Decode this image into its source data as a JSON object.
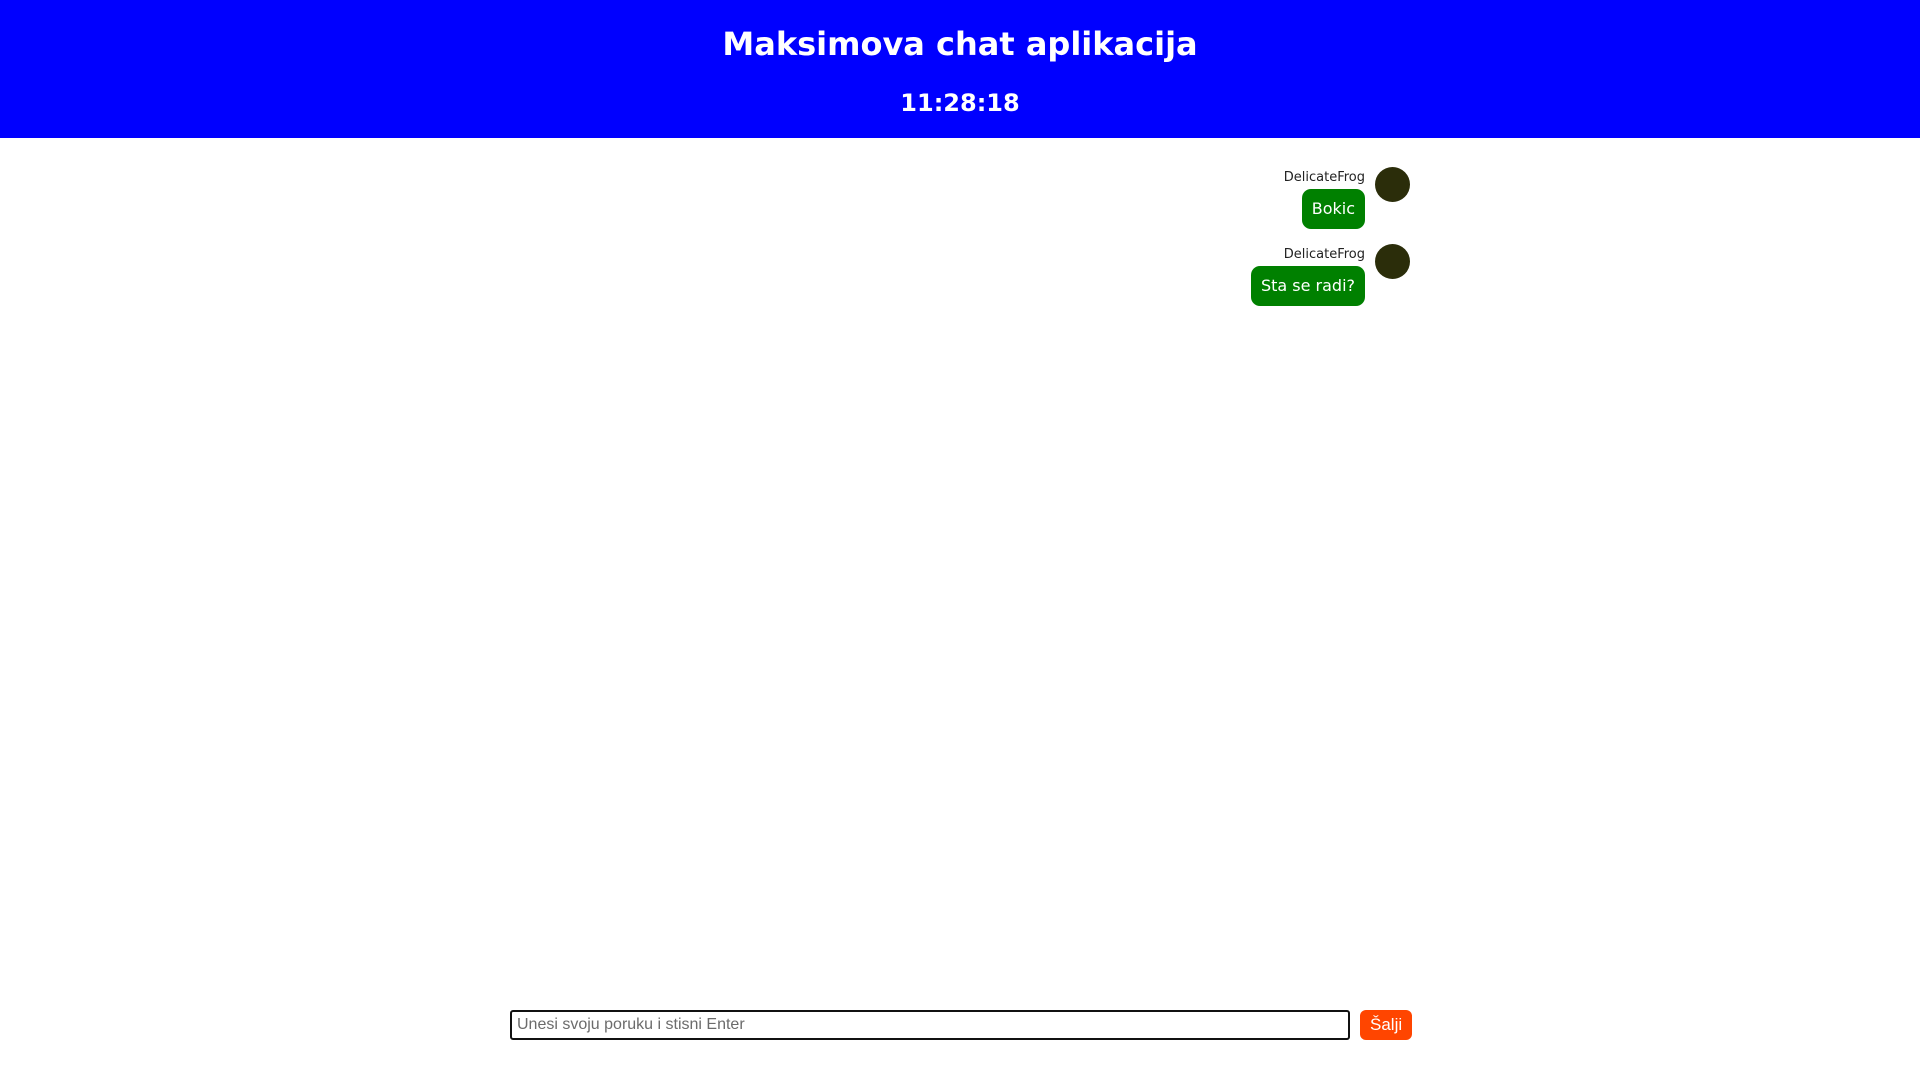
{
  "header": {
    "title": "Maksimova chat aplikacija",
    "clock": "11:28:18"
  },
  "messages": [
    {
      "sender": "DelicateFrog",
      "text": "Bokic"
    },
    {
      "sender": "DelicateFrog",
      "text": "Sta se radi?"
    }
  ],
  "composer": {
    "placeholder": "Unesi svoju poruku i stisni Enter",
    "value": "",
    "send_label": "Šalji"
  },
  "colors": {
    "header_bg": "#0000ff",
    "bubble_bg": "#008000",
    "avatar": "#2b2d0a",
    "send_button_bg": "#ff4500"
  }
}
